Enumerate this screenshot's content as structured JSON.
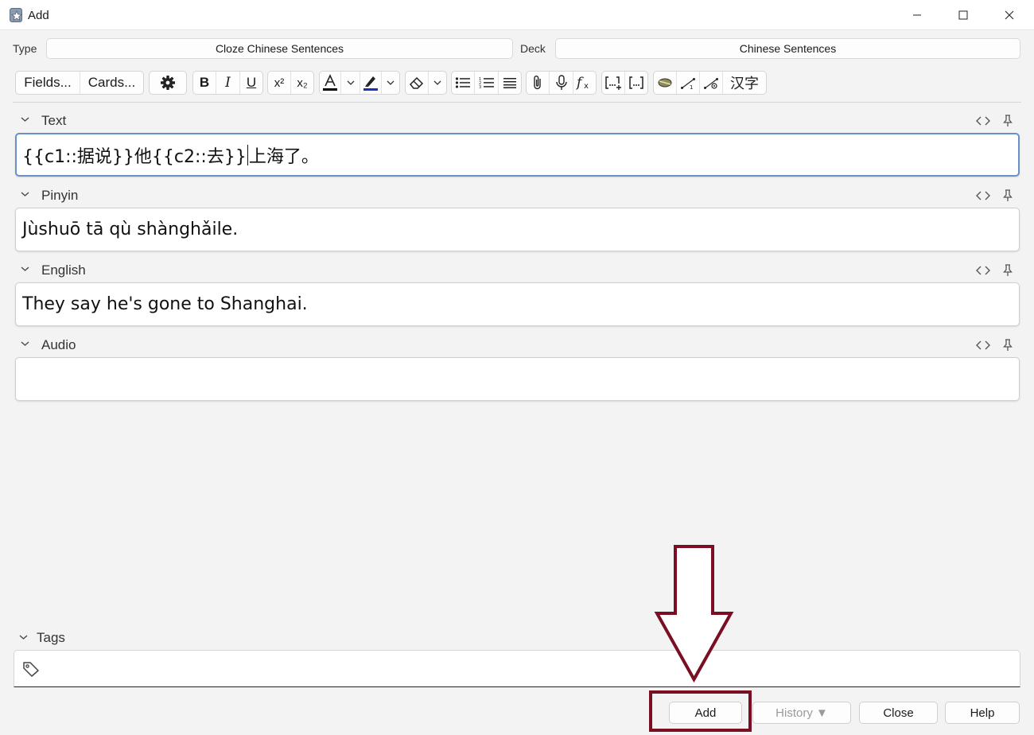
{
  "window": {
    "title": "Add",
    "app_icon": "anki-star-icon",
    "controls": [
      "minimize-icon",
      "maximize-icon",
      "close-icon"
    ]
  },
  "type_row": {
    "type_label": "Type",
    "type_value": "Cloze Chinese Sentences",
    "deck_label": "Deck",
    "deck_value": "Chinese Sentences"
  },
  "toolbar": {
    "fields_label": "Fields...",
    "cards_label": "Cards...",
    "settings_icon": "gear-icon",
    "bold": "B",
    "italic": "I",
    "underline": "U",
    "superscript": "x²",
    "subscript": "x₂",
    "text_color": "#000000",
    "highlight_color": "#1f2fb5",
    "hanzi": "汉字"
  },
  "fields": [
    {
      "name": "Text",
      "value_before_caret": "{{c1::据说}}他{{c2::去}}",
      "value_after_caret": "上海了。",
      "focused": true
    },
    {
      "name": "Pinyin",
      "value": "Jùshuō tā qù shànghǎile."
    },
    {
      "name": "English",
      "value": "They say he's gone to Shanghai."
    },
    {
      "name": "Audio",
      "value": ""
    }
  ],
  "tags": {
    "label": "Tags",
    "value": ""
  },
  "buttons": {
    "add": "Add",
    "history": "History ▼",
    "close": "Close",
    "help": "Help"
  },
  "annotation": {
    "color": "#7a0f24"
  }
}
